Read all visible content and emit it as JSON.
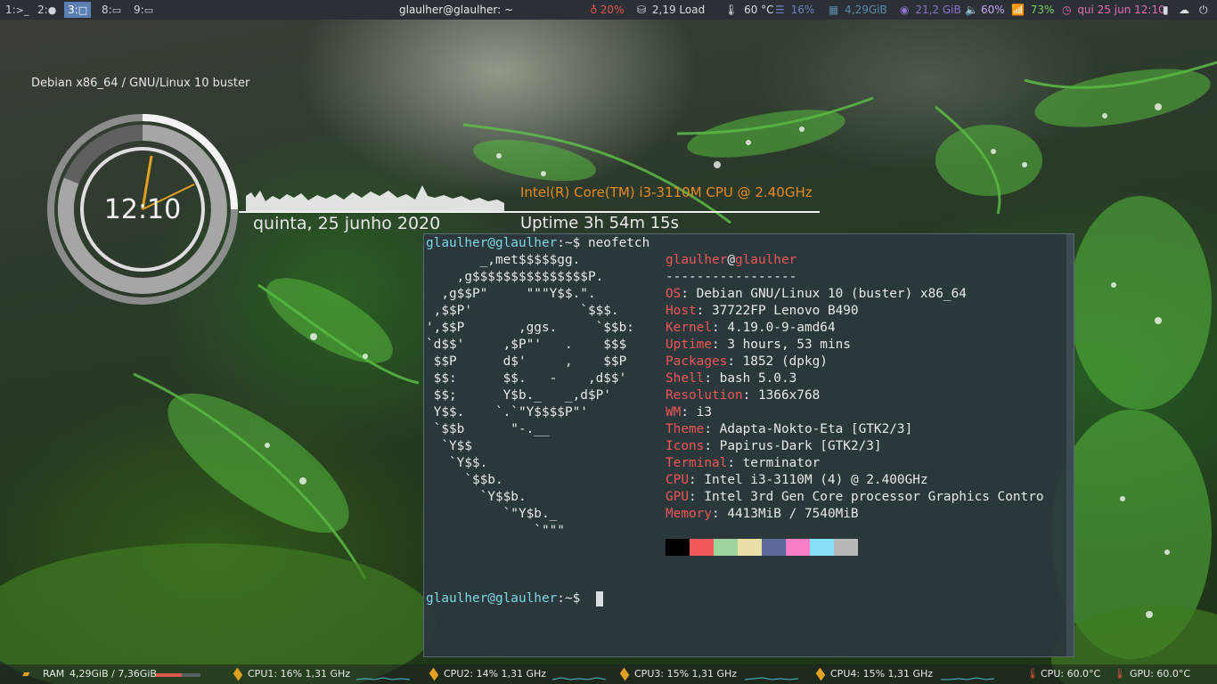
{
  "topbar": {
    "workspaces": [
      {
        "num": "1:",
        "icon": ">_",
        "active": false
      },
      {
        "num": "2:",
        "icon": "●",
        "active": false
      },
      {
        "num": "3:",
        "icon": "□",
        "active": true
      },
      {
        "num": "8:",
        "icon": "▭",
        "active": false
      },
      {
        "num": "9:",
        "icon": "▭",
        "active": false
      }
    ],
    "window_title": "glaulher@glaulher: ~",
    "cpu_percent": "20%",
    "load": "2,19 Load",
    "temp": "60 °C",
    "disk_percent": "16%",
    "ram": "4,29GiB",
    "swap": "21,2 GiB",
    "volume": "60%",
    "wifi": "73%",
    "datetime": "qui 25 jun 12:10",
    "colors": {
      "cpu": "#e0554a",
      "disk": "#6f7fc0",
      "ram": "#5b8aa8",
      "swap": "#8e6fcf",
      "volume": "#b48ee0",
      "wifi": "#6fd25a",
      "clock": "#e06fb0"
    }
  },
  "conky": {
    "os_line": "Debian x86_64 / GNU/Linux 10 buster",
    "clock": "12:10",
    "date": "quinta, 25 junho 2020",
    "cpu_model": "Intel(R) Core(TM) i3-3110M CPU @ 2.40GHz",
    "uptime": "Uptime 3h 54m 15s"
  },
  "terminal": {
    "prompt_user": "glaulher@glaulher",
    "prompt_suffix": ":~$ ",
    "command": "neofetch",
    "art": [
      "       _,met$$$$$gg.",
      "    ,g$$$$$$$$$$$$$$$P.",
      "  ,g$$P\"     \"\"\"Y$$.\".",
      " ,$$P'              `$$$.",
      "',$$P       ,ggs.     `$$b:",
      "`d$$'     ,$P\"'   .    $$$",
      " $$P      d$'     ,    $$P",
      " $$:      $$.   -    ,d$$'",
      " $$;      Y$b._   _,d$P'",
      " Y$$.    `.`\"Y$$$$P\"'",
      " `$$b      \"-.__",
      "  `Y$$",
      "   `Y$$.",
      "     `$$b.",
      "       `Y$$b.",
      "          `\"Y$b._",
      "              `\"\"\""
    ],
    "info_user": "glaulher",
    "info_at": "@",
    "info_host": "glaulher",
    "separator": "-----------------",
    "info": [
      {
        "key": "OS",
        "value": "Debian GNU/Linux 10 (buster) x86_64"
      },
      {
        "key": "Host",
        "value": "37722FP Lenovo B490"
      },
      {
        "key": "Kernel",
        "value": "4.19.0-9-amd64"
      },
      {
        "key": "Uptime",
        "value": "3 hours, 53 mins"
      },
      {
        "key": "Packages",
        "value": "1852 (dpkg)"
      },
      {
        "key": "Shell",
        "value": "bash 5.0.3"
      },
      {
        "key": "Resolution",
        "value": "1366x768"
      },
      {
        "key": "WM",
        "value": "i3"
      },
      {
        "key": "Theme",
        "value": "Adapta-Nokto-Eta [GTK2/3]"
      },
      {
        "key": "Icons",
        "value": "Papirus-Dark [GTK2/3]"
      },
      {
        "key": "Terminal",
        "value": "terminator"
      },
      {
        "key": "CPU",
        "value": "Intel i3-3110M (4) @ 2.400GHz"
      },
      {
        "key": "GPU",
        "value": "Intel 3rd Gen Core processor Graphics Contro"
      },
      {
        "key": "Memory",
        "value": "4413MiB / 7540MiB"
      }
    ],
    "palette": [
      "#000000",
      "#f25a5a",
      "#9fd49f",
      "#eadfa6",
      "#5c6a9c",
      "#f77ec4",
      "#86e1f7",
      "#b8b8b8"
    ]
  },
  "bottombar": {
    "ram_label": "RAM",
    "ram_value": "4,29GiB / 7,36GiB",
    "ram_fraction": 0.58,
    "cpus": [
      {
        "label": "CPU1: 16%",
        "freq": "1,31 GHz"
      },
      {
        "label": "CPU2: 14%",
        "freq": "1,31 GHz"
      },
      {
        "label": "CPU3: 15%",
        "freq": "1,31 GHz"
      },
      {
        "label": "CPU4: 15%",
        "freq": "1,31 GHz"
      }
    ],
    "cpu_temp": "CPU: 60.0°C",
    "gpu_temp": "GPU: 60.0°C"
  }
}
